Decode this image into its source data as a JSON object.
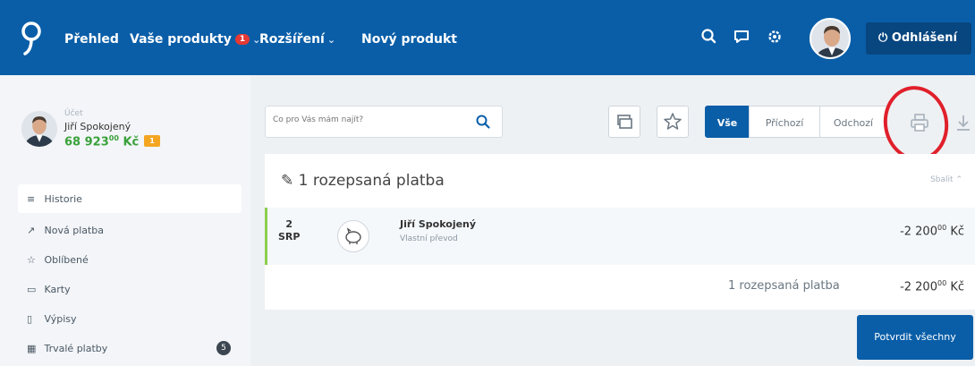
{
  "nav": {
    "items": [
      {
        "label": "Přehled"
      },
      {
        "label": "Vaše produkty",
        "badge": "1"
      },
      {
        "label": "Rozšíření"
      },
      {
        "label": "Nový produkt"
      }
    ],
    "caret": "⌄",
    "logout_label": "Odhlášení",
    "icons": [
      "search-icon",
      "chat-icon",
      "settings-icon",
      "power-icon"
    ]
  },
  "account": {
    "label": "Účet",
    "name": "Jiří Spokojený",
    "balance_main": "68 923",
    "balance_cents": "00",
    "currency": "Kč",
    "tag": "1"
  },
  "sidebar": {
    "items": [
      {
        "icon": "list-icon",
        "glyph": "≡",
        "label": "Historie"
      },
      {
        "icon": "send-icon",
        "glyph": "↗",
        "label": "Nová platba"
      },
      {
        "icon": "star-icon",
        "glyph": "☆",
        "label": "Oblíbené"
      },
      {
        "icon": "card-icon",
        "glyph": "▭",
        "label": "Karty"
      },
      {
        "icon": "document-icon",
        "glyph": "▯",
        "label": "Výpisy"
      },
      {
        "icon": "calendar-icon",
        "glyph": "▦",
        "label": "Trvalé platby",
        "count": "5"
      }
    ]
  },
  "search": {
    "placeholder": "Co pro Vás mám najít?"
  },
  "filters": {
    "all": "Vše",
    "incoming": "Příchozí",
    "outgoing": "Odchozí"
  },
  "card": {
    "title": "1 rozepsaná platba",
    "collapse": "Sbalit",
    "payment": {
      "day": "2",
      "month": "SRP",
      "name": "Jiří Spokojený",
      "description": "Vlastní převod",
      "amount_main": "-2 200",
      "amount_cents": "00",
      "currency": "Kč"
    },
    "summary_label": "1 rozepsaná platba",
    "summary_amount_main": "-2 200",
    "summary_amount_cents": "00",
    "summary_currency": "Kč"
  },
  "confirm_label": "Potvrdit všechny",
  "colors": {
    "primary": "#0a5ea8",
    "balance": "#3aa13a",
    "highlight": "#e0202b"
  }
}
